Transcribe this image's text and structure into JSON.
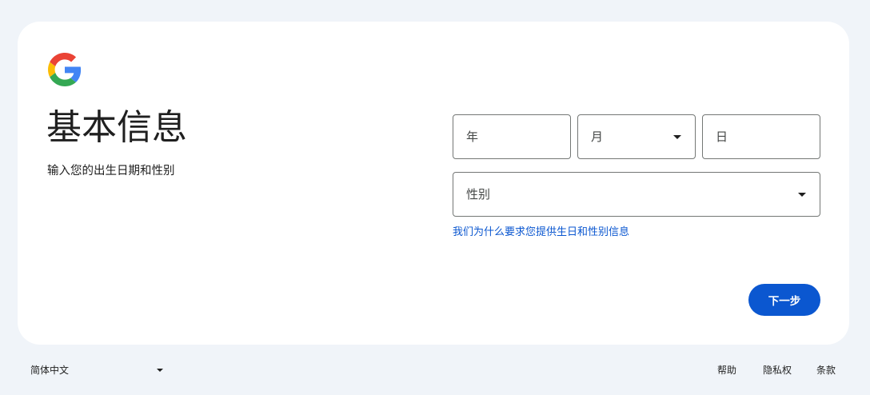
{
  "page": {
    "title": "基本信息",
    "subtitle": "输入您的出生日期和性别"
  },
  "form": {
    "year_placeholder": "年",
    "month_placeholder": "月",
    "day_placeholder": "日",
    "gender_placeholder": "性别",
    "why_link": "我们为什么要求您提供生日和性别信息",
    "next_label": "下一步"
  },
  "footer": {
    "language": "简体中文",
    "help": "帮助",
    "privacy": "隐私权",
    "terms": "条款"
  },
  "colors": {
    "accent": "#0b57d0",
    "background": "#f0f4f9",
    "card": "#ffffff"
  },
  "icons": {
    "logo": "google-g-logo",
    "dropdown": "caret-down-icon"
  }
}
